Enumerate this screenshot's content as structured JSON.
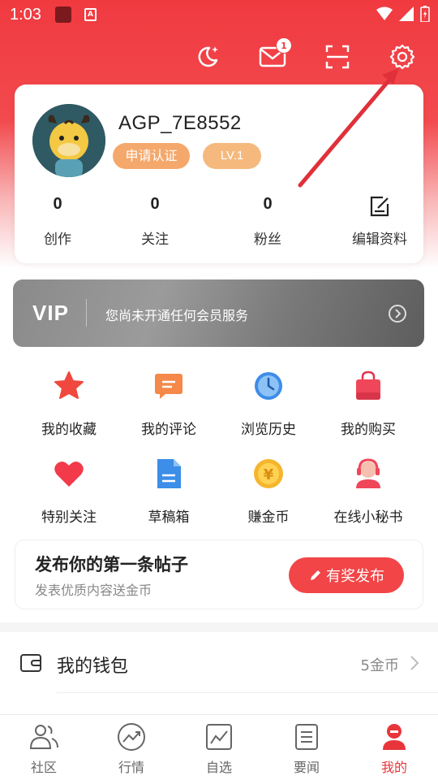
{
  "status_bar": {
    "time": "1:03"
  },
  "header": {
    "mail_count": "1"
  },
  "profile": {
    "username": "AGP_7E8552",
    "cert_label": "申请认证",
    "level_label": "LV.1",
    "stats": [
      {
        "value": "0",
        "label": "创作"
      },
      {
        "value": "0",
        "label": "关注"
      },
      {
        "value": "0",
        "label": "粉丝"
      }
    ],
    "edit_label": "编辑资料"
  },
  "vip": {
    "title": "VIP",
    "text": "您尚未开通任何会员服务"
  },
  "menu": [
    {
      "label": "我的收藏",
      "icon": "star-icon"
    },
    {
      "label": "我的评论",
      "icon": "comment-icon"
    },
    {
      "label": "浏览历史",
      "icon": "clock-icon"
    },
    {
      "label": "我的购买",
      "icon": "shopping-bag-icon"
    },
    {
      "label": "特别关注",
      "icon": "heart-icon"
    },
    {
      "label": "草稿箱",
      "icon": "draft-icon"
    },
    {
      "label": "赚金币",
      "icon": "coin-icon"
    },
    {
      "label": "在线小秘书",
      "icon": "assistant-icon"
    }
  ],
  "post_prompt": {
    "title": "发布你的第一条帖子",
    "subtitle": "发表优质内容送金币",
    "button": "有奖发布"
  },
  "wallet": {
    "label": "我的钱包",
    "value": "5金币"
  },
  "nav": [
    {
      "label": "社区",
      "icon": "community-icon"
    },
    {
      "label": "行情",
      "icon": "market-icon"
    },
    {
      "label": "自选",
      "icon": "watchlist-icon"
    },
    {
      "label": "要闻",
      "icon": "news-icon"
    },
    {
      "label": "我的",
      "icon": "profile-icon",
      "active": true
    }
  ],
  "colors": {
    "brand_red": "#f03a40",
    "vip_gray": "#8a8a8a",
    "badge_orange": "#f5a86b"
  }
}
